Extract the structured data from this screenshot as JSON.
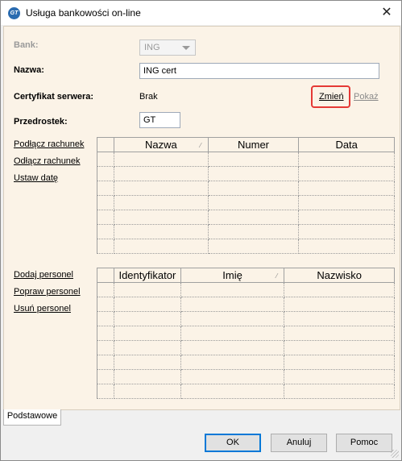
{
  "window": {
    "title": "Usługa bankowości on-line",
    "close_symbol": "✕",
    "icon_text": "GT"
  },
  "form": {
    "bank_label": "Bank:",
    "bank_value": "ING",
    "name_label": "Nazwa:",
    "name_value": "ING cert",
    "cert_label": "Certyfikat serwera:",
    "cert_value": "Brak",
    "cert_change_link": "Zmień",
    "cert_show_link": "Pokaż",
    "prefix_label": "Przedrostek:",
    "prefix_value": "GT"
  },
  "accounts": {
    "actions": [
      "Podłącz rachunek",
      "Odłącz rachunek",
      "Ustaw datę"
    ],
    "columns": [
      "Nazwa",
      "Numer",
      "Data"
    ],
    "sort_mark": "⁄",
    "empty_rows": 7
  },
  "personnel": {
    "actions": [
      "Dodaj personel",
      "Popraw personel",
      "Usuń personel"
    ],
    "columns": [
      "Identyfikator",
      "Imię",
      "Nazwisko"
    ],
    "sort_mark": "⁄",
    "empty_rows": 8
  },
  "tabs": [
    "Podstawowe"
  ],
  "buttons": {
    "ok": "OK",
    "cancel": "Anuluj",
    "help": "Pomoc"
  },
  "colors": {
    "form_bg": "#fbf3e7",
    "highlight": "#e53935",
    "default_button_border": "#0078d7"
  }
}
